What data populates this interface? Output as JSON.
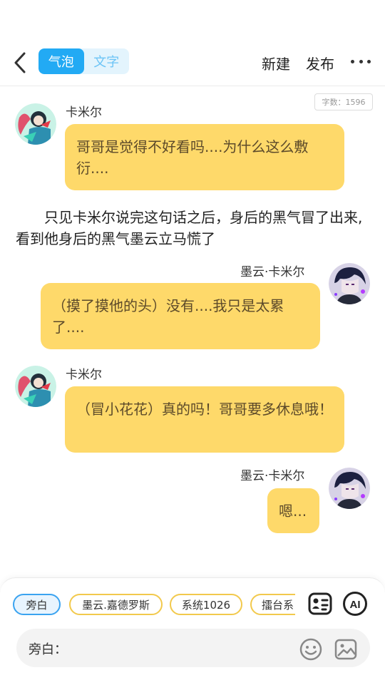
{
  "header": {
    "segments": [
      "气泡",
      "文字"
    ],
    "new_label": "新建",
    "publish_label": "发布"
  },
  "word_count": "字数：1596",
  "messages": [
    {
      "speaker": "卡米尔",
      "text": "哥哥是觉得不好看吗....为什么这么敷衍...."
    },
    {
      "narration": "只见卡米尔说完这句话之后，身后的黑气冒了出来,看到他身后的黑气墨云立马慌了"
    },
    {
      "speaker": "墨云·卡米尔",
      "text": "（摸了摸他的头）没有....我只是太累了...."
    },
    {
      "speaker": "卡米尔",
      "text": "（冒小花花）真的吗！哥哥要多休息哦！"
    },
    {
      "speaker": "墨云·卡米尔",
      "text": "嗯..."
    }
  ],
  "composer": {
    "chips": [
      "旁白",
      "墨云.嘉德罗斯",
      "系统1026",
      "擂台系"
    ],
    "input_label": "旁白：",
    "ai_label": "AI"
  }
}
